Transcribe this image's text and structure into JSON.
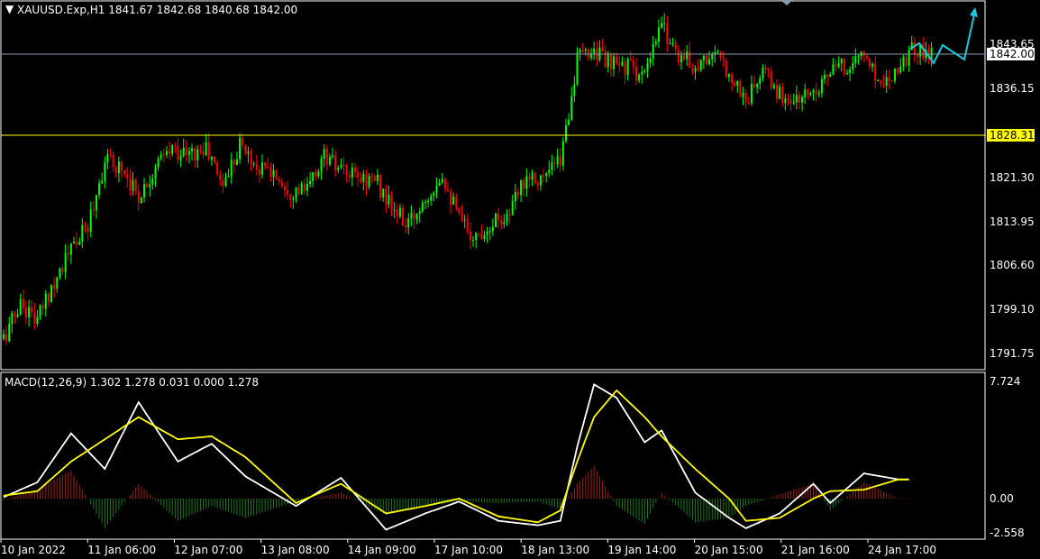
{
  "header": {
    "menu_icon": "triangle-down-icon",
    "symbol_info": "XAUUSD.Exp,H1  1841.67 1842.68 1840.68 1842.00"
  },
  "macd_header": "MACD(12,26,9) 1.302 1.278 0.031 0.000 1.278",
  "colors": {
    "background": "#000000",
    "bull": "#00ff00",
    "bear": "#ff0000",
    "frame": "#ffffff",
    "bid_line": "#8899aa",
    "level_line": "#ffff00",
    "macd_line": "#ffffff",
    "signal_line": "#ffff00",
    "hist_pos": "#a0201a",
    "hist_neg": "#1e7a1e",
    "arrow": "#1ec8dc"
  },
  "price_tags": {
    "current": "1842.00",
    "level": "1828.31"
  },
  "price_axis": [
    "1843.65",
    "1836.15",
    "1828.31",
    "1821.30",
    "1813.95",
    "1806.60",
    "1799.10",
    "1791.75"
  ],
  "macd_axis": [
    "7.724",
    "0.00",
    "-2.558"
  ],
  "time_axis": [
    "10 Jan 2022",
    "11 Jan 06:00",
    "12 Jan 07:00",
    "13 Jan 08:00",
    "14 Jan 09:00",
    "17 Jan 10:00",
    "18 Jan 13:00",
    "19 Jan 14:00",
    "20 Jan 15:00",
    "21 Jan 16:00",
    "24 Jan 17:00"
  ],
  "chart_data": {
    "type": "candlestick",
    "symbol": "XAUUSD.Exp",
    "timeframe": "H1",
    "ohlc_last": {
      "open": 1841.67,
      "high": 1842.68,
      "low": 1840.68,
      "close": 1842.0
    },
    "price_range": [
      1789.5,
      1851.5
    ],
    "horizontal_levels": [
      1842.0,
      1828.31
    ],
    "close_path": [
      [
        0,
        1794
      ],
      [
        6,
        1800
      ],
      [
        12,
        1797
      ],
      [
        18,
        1804
      ],
      [
        24,
        1809
      ],
      [
        30,
        1813
      ],
      [
        36,
        1824
      ],
      [
        42,
        1823
      ],
      [
        48,
        1818
      ],
      [
        54,
        1823
      ],
      [
        60,
        1826
      ],
      [
        66,
        1825
      ],
      [
        72,
        1826
      ],
      [
        78,
        1820
      ],
      [
        84,
        1827
      ],
      [
        90,
        1823
      ],
      [
        96,
        1822
      ],
      [
        102,
        1819
      ],
      [
        108,
        1819
      ],
      [
        114,
        1825
      ],
      [
        120,
        1822
      ],
      [
        126,
        1821
      ],
      [
        132,
        1821
      ],
      [
        138,
        1816
      ],
      [
        144,
        1813
      ],
      [
        150,
        1818
      ],
      [
        156,
        1822
      ],
      [
        162,
        1814
      ],
      [
        168,
        1811
      ],
      [
        174,
        1814
      ],
      [
        180,
        1815
      ],
      [
        186,
        1822
      ],
      [
        192,
        1821
      ],
      [
        198,
        1824
      ],
      [
        204,
        1841
      ],
      [
        210,
        1843
      ],
      [
        216,
        1840
      ],
      [
        222,
        1840
      ],
      [
        228,
        1838
      ],
      [
        234,
        1847
      ],
      [
        240,
        1842
      ],
      [
        246,
        1840
      ],
      [
        252,
        1842
      ],
      [
        258,
        1839
      ],
      [
        264,
        1834
      ],
      [
        270,
        1839
      ],
      [
        276,
        1835
      ],
      [
        282,
        1834
      ],
      [
        288,
        1836
      ],
      [
        294,
        1839
      ],
      [
        300,
        1840
      ],
      [
        306,
        1842
      ],
      [
        312,
        1837
      ],
      [
        318,
        1840
      ],
      [
        324,
        1843
      ],
      [
        330,
        1842
      ]
    ],
    "macd_range": [
      -2.558,
      7.724
    ],
    "macd_series": {
      "macd_key": [
        [
          0,
          0.1
        ],
        [
          12,
          1.1
        ],
        [
          24,
          4.4
        ],
        [
          36,
          2.0
        ],
        [
          48,
          6.5
        ],
        [
          62,
          2.5
        ],
        [
          74,
          3.7
        ],
        [
          86,
          1.5
        ],
        [
          104,
          -0.5
        ],
        [
          120,
          1.4
        ],
        [
          136,
          -2.1
        ],
        [
          150,
          -1.0
        ],
        [
          162,
          -0.2
        ],
        [
          176,
          -1.5
        ],
        [
          190,
          -1.8
        ],
        [
          198,
          -1.5
        ],
        [
          204,
          3.5
        ],
        [
          210,
          7.7
        ],
        [
          218,
          6.8
        ],
        [
          228,
          3.8
        ],
        [
          234,
          4.6
        ],
        [
          246,
          0.4
        ],
        [
          258,
          -1.3
        ],
        [
          264,
          -2.0
        ],
        [
          276,
          -1.0
        ],
        [
          288,
          1.0
        ],
        [
          294,
          -0.3
        ],
        [
          306,
          1.7
        ],
        [
          318,
          1.302
        ]
      ],
      "signal_key": [
        [
          0,
          0.2
        ],
        [
          12,
          0.5
        ],
        [
          24,
          2.5
        ],
        [
          36,
          4.0
        ],
        [
          48,
          5.5
        ],
        [
          62,
          4.0
        ],
        [
          74,
          4.2
        ],
        [
          86,
          2.8
        ],
        [
          104,
          -0.3
        ],
        [
          120,
          1.0
        ],
        [
          136,
          -1.0
        ],
        [
          150,
          -0.5
        ],
        [
          162,
          0.0
        ],
        [
          176,
          -1.2
        ],
        [
          190,
          -1.6
        ],
        [
          198,
          -0.8
        ],
        [
          204,
          2.5
        ],
        [
          210,
          5.5
        ],
        [
          218,
          7.3
        ],
        [
          228,
          5.5
        ],
        [
          234,
          4.2
        ],
        [
          246,
          2.0
        ],
        [
          258,
          0.0
        ],
        [
          264,
          -1.5
        ],
        [
          276,
          -1.3
        ],
        [
          288,
          0.0
        ],
        [
          294,
          0.5
        ],
        [
          306,
          0.6
        ],
        [
          318,
          1.278
        ]
      ]
    }
  }
}
